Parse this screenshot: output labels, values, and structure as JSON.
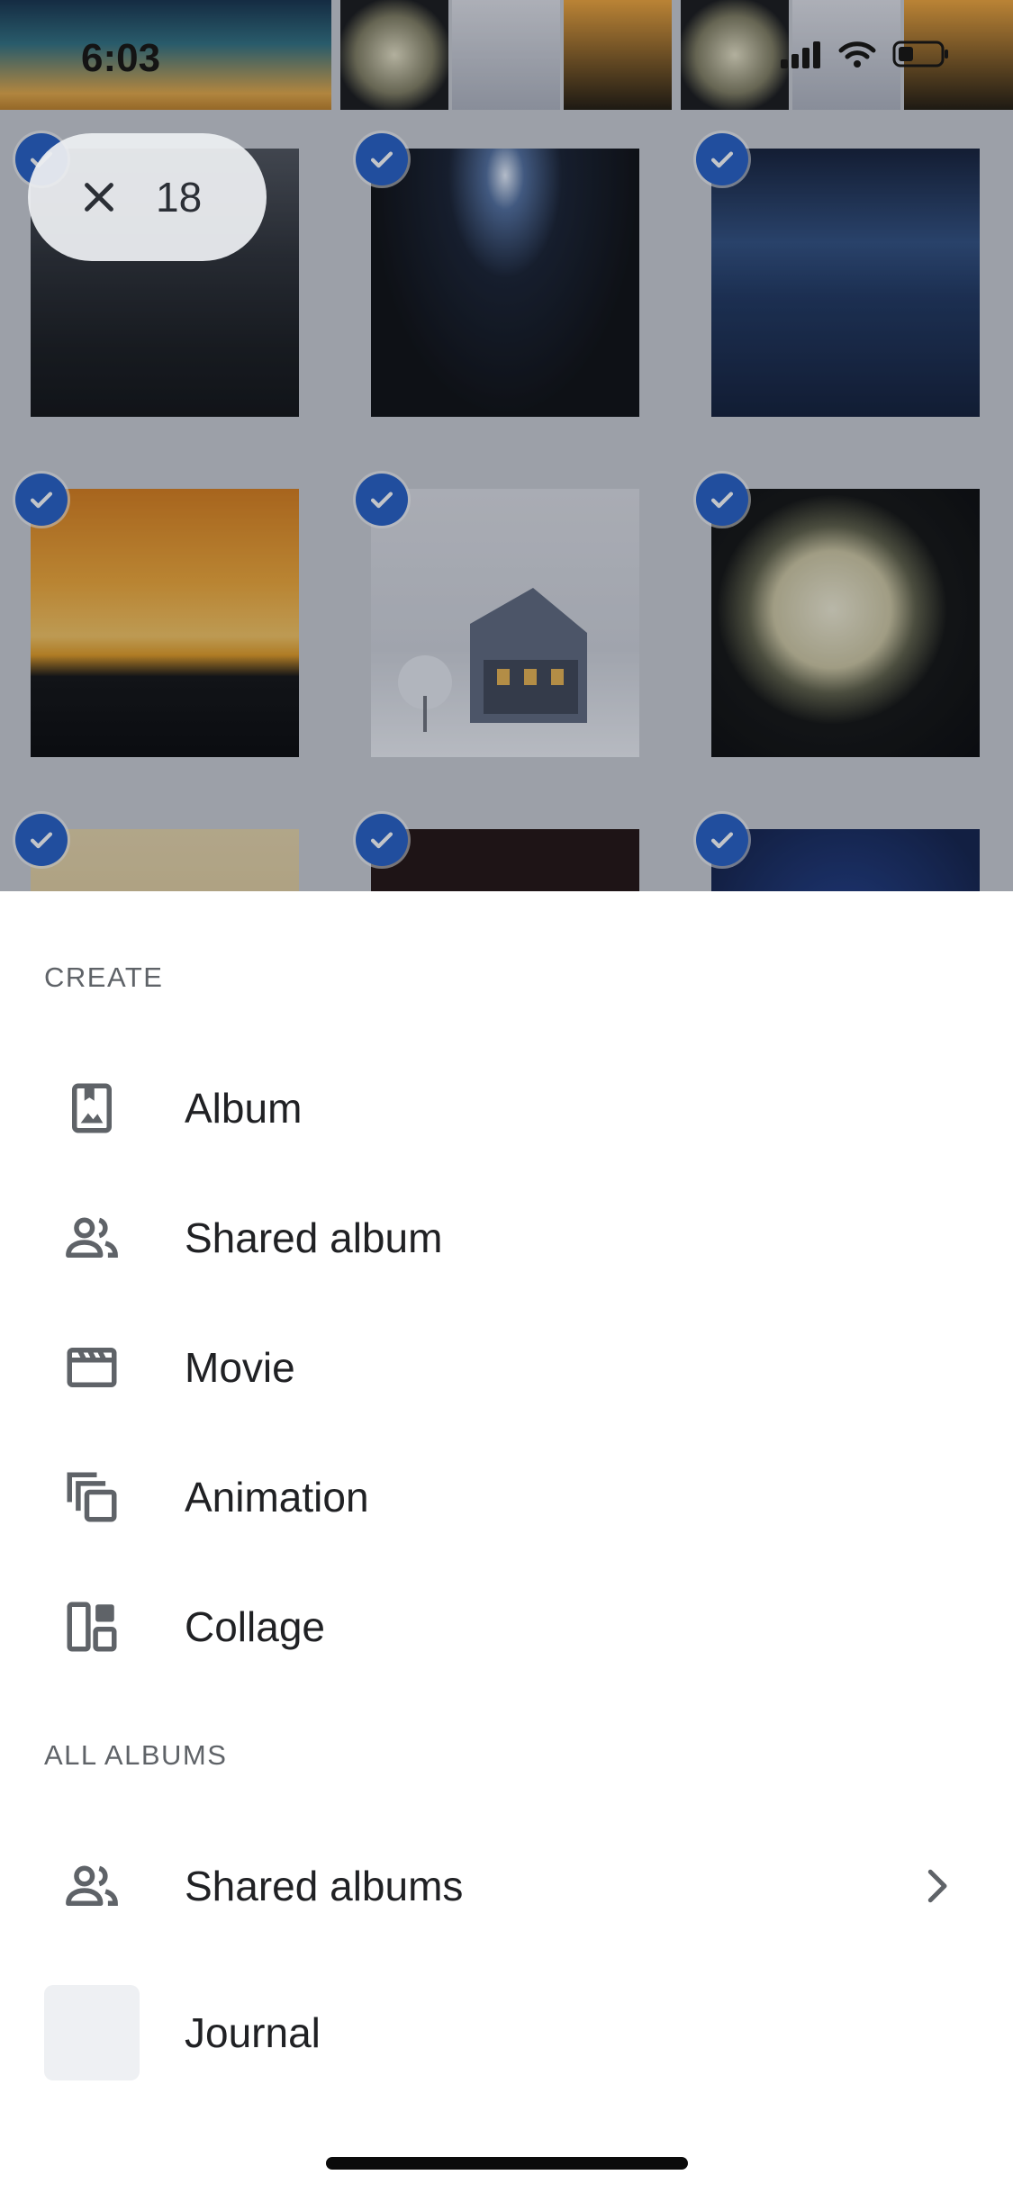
{
  "status_bar": {
    "time": "6:03"
  },
  "selection": {
    "count": "18"
  },
  "sheet": {
    "create_header": "CREATE",
    "create_items": [
      {
        "label": "Album"
      },
      {
        "label": "Shared album"
      },
      {
        "label": "Movie"
      },
      {
        "label": "Animation"
      },
      {
        "label": "Collage"
      }
    ],
    "all_albums_header": "ALL ALBUMS",
    "albums": [
      {
        "label": "Shared albums"
      },
      {
        "label": "Journal"
      }
    ]
  },
  "colors": {
    "accent": "#1f5bc4",
    "text": "#202124",
    "muted": "#5f6368"
  }
}
